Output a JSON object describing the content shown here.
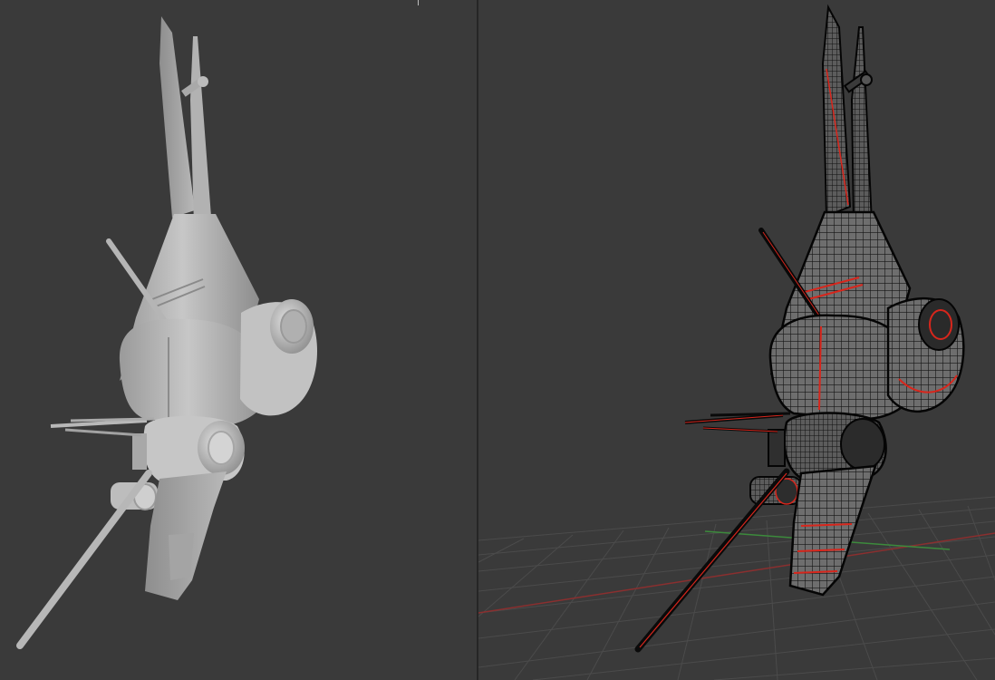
{
  "viewports": [
    {
      "shading": "solid",
      "background": "#3a3a3a",
      "model_color": "#c9c9c9"
    },
    {
      "shading": "wireframe",
      "background": "#3a3a3a",
      "model_color": "#0d0d0d",
      "edge_highlight": "#d8261c",
      "grid": true,
      "x_axis_color": "#8a2f2f",
      "y_axis_color": "#3c8a3c"
    }
  ]
}
